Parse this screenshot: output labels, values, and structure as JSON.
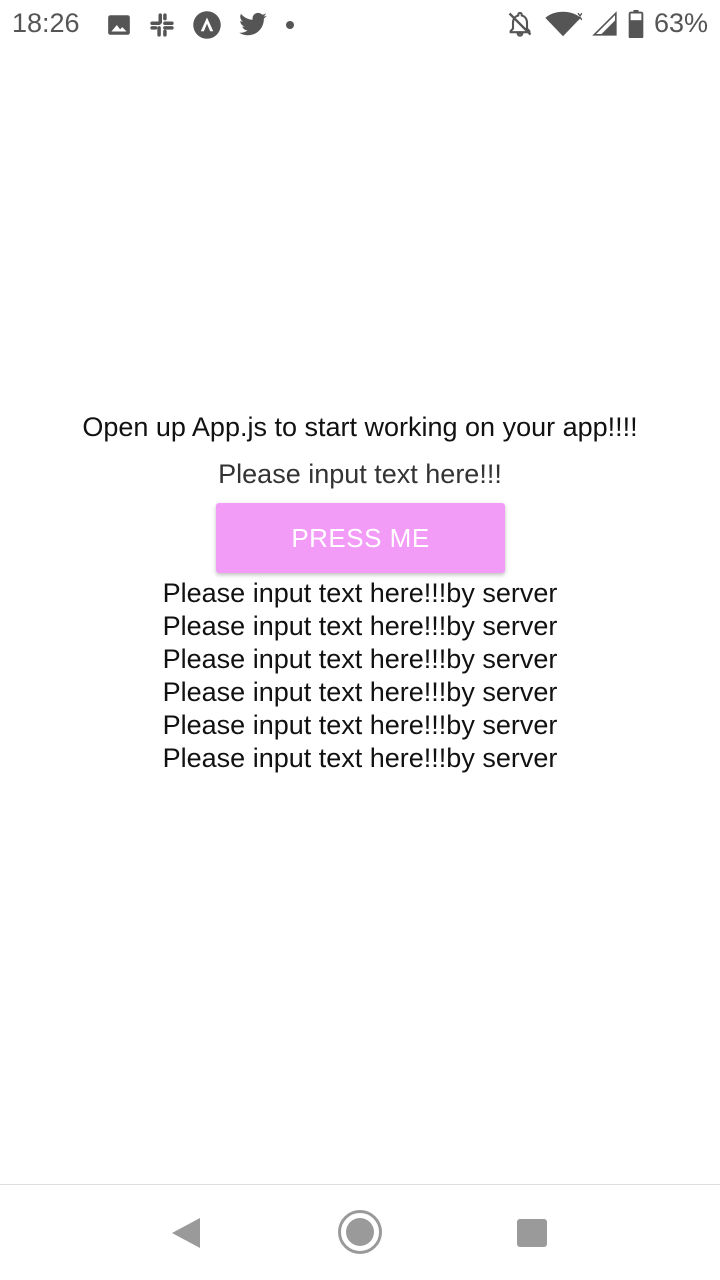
{
  "status_bar": {
    "time": "18:26",
    "battery_percent": "63%",
    "left_icons": [
      "image-icon",
      "slack-icon",
      "expo-icon",
      "twitter-icon",
      "dot-icon"
    ],
    "right_icons": [
      "bell-off-icon",
      "wifi-icon",
      "signal-icon",
      "battery-icon"
    ]
  },
  "app": {
    "welcome_text": "Open up App.js to start working on your app!!!!",
    "input_text": "Please input text here!!!",
    "button_label": "PRESS ME",
    "button_color": "#f29cf7",
    "server_lines": [
      "Please input text here!!!by server",
      "Please input text here!!!by server",
      "Please input text here!!!by server",
      "Please input text here!!!by server",
      "Please input text here!!!by server",
      "Please input text here!!!by server"
    ]
  },
  "nav_bar": {
    "buttons": [
      "back-icon",
      "home-icon",
      "recents-icon"
    ]
  }
}
